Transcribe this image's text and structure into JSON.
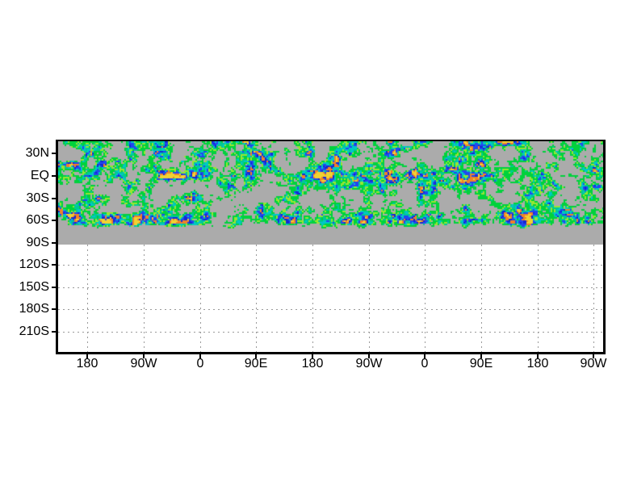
{
  "chart_data": {
    "type": "heatmap",
    "title": "",
    "x_tick_labels": [
      "180",
      "90W",
      "0",
      "90E",
      "180",
      "90W",
      "0",
      "90E",
      "180",
      "90W"
    ],
    "y_tick_labels": [
      "30N",
      "EQ",
      "30S",
      "60S",
      "90S",
      "120S",
      "150S",
      "180S",
      "210S"
    ],
    "grid": true,
    "gridline_style": "dotted",
    "gridline_color": "#9a9a9a",
    "axis_color": "#000000",
    "background_color": "#ffffff",
    "field_background_color": "#ababab",
    "shading_palette": [
      {
        "name": "green",
        "hex": "#00d23c"
      },
      {
        "name": "yellow-green",
        "hex": "#96e632"
      },
      {
        "name": "teal",
        "hex": "#00c896"
      },
      {
        "name": "cyan",
        "hex": "#00c8c8"
      },
      {
        "name": "blue",
        "hex": "#2346f0"
      },
      {
        "name": "dark-blue",
        "hex": "#1428d2"
      },
      {
        "name": "orange",
        "hex": "#f08228"
      },
      {
        "name": "yellow",
        "hex": "#f0d232"
      }
    ],
    "field_note": "pixelated shaded field occupies the upper band of the plot (between the 30N top edge and just past 60S); the remainder of that band is flat gray; area below 90S is empty with dotted gridlines"
  }
}
